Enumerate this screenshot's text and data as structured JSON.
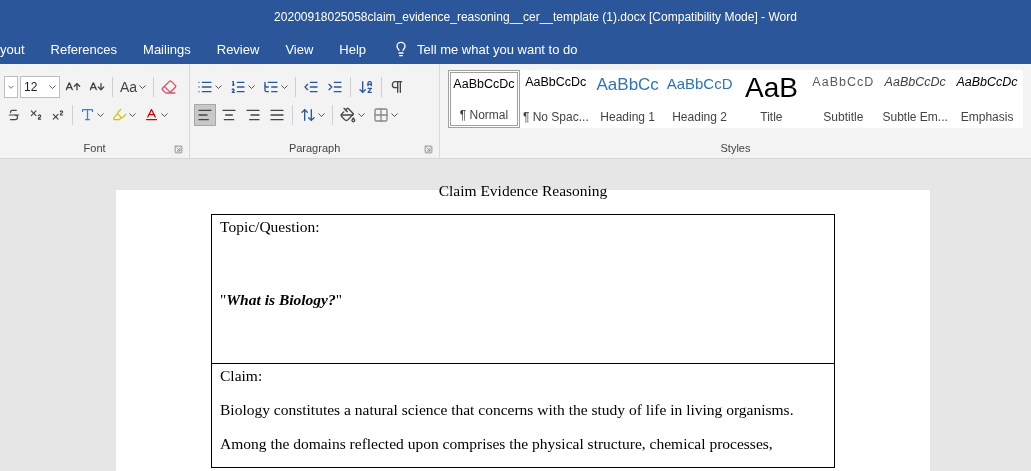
{
  "window": {
    "title": "20200918025058claim_evidence_reasoning__cer__template (1).docx [Compatibility Mode]  -  Word"
  },
  "tabs": [
    {
      "label": "yout",
      "selected": false
    },
    {
      "label": "References",
      "selected": false
    },
    {
      "label": "Mailings",
      "selected": false
    },
    {
      "label": "Review",
      "selected": false
    },
    {
      "label": "View",
      "selected": false
    },
    {
      "label": "Help",
      "selected": false
    }
  ],
  "tell_me": {
    "placeholder": "Tell me what you want to do"
  },
  "ribbon": {
    "font": {
      "label": "Font",
      "size": "12",
      "change_case": "Aa"
    },
    "paragraph": {
      "label": "Paragraph",
      "align_left_on": true,
      "align_center_on": false,
      "align_right_on": false,
      "justify_on": false
    },
    "styles": {
      "label": "Styles",
      "items": [
        {
          "kind": "normal",
          "preview": "AaBbCcDc",
          "name": "¶ Normal",
          "selected": true
        },
        {
          "kind": "normal",
          "preview": "AaBbCcDc",
          "name": "¶ No Spac...",
          "selected": false
        },
        {
          "kind": "heading1",
          "preview": "AaBbCc",
          "name": "Heading 1",
          "selected": false
        },
        {
          "kind": "heading2",
          "preview": "AaBbCcD",
          "name": "Heading 2",
          "selected": false
        },
        {
          "kind": "title",
          "preview": "AaB",
          "name": "Title",
          "selected": false
        },
        {
          "kind": "subtitle",
          "preview": "AaBbCcD",
          "name": "Subtitle",
          "selected": false
        },
        {
          "kind": "subtle",
          "preview": "AaBbCcDc",
          "name": "Subtle Em...",
          "selected": false
        },
        {
          "kind": "emphasis",
          "preview": "AaBbCcDc",
          "name": "Emphasis",
          "selected": false
        }
      ]
    }
  },
  "document": {
    "heading": "Claim Evidence Reasoning",
    "rows": [
      {
        "label": "Topic/Question:",
        "question": {
          "open_quote": "\"",
          "text": "What is Biology?",
          "close_quote": "\""
        }
      },
      {
        "label": "Claim:",
        "paragraphs": [
          "Biology constitutes a natural science that concerns with the study of life in living organisms.",
          "Among the domains reflected upon comprises the physical structure, chemical processes,"
        ]
      }
    ]
  }
}
